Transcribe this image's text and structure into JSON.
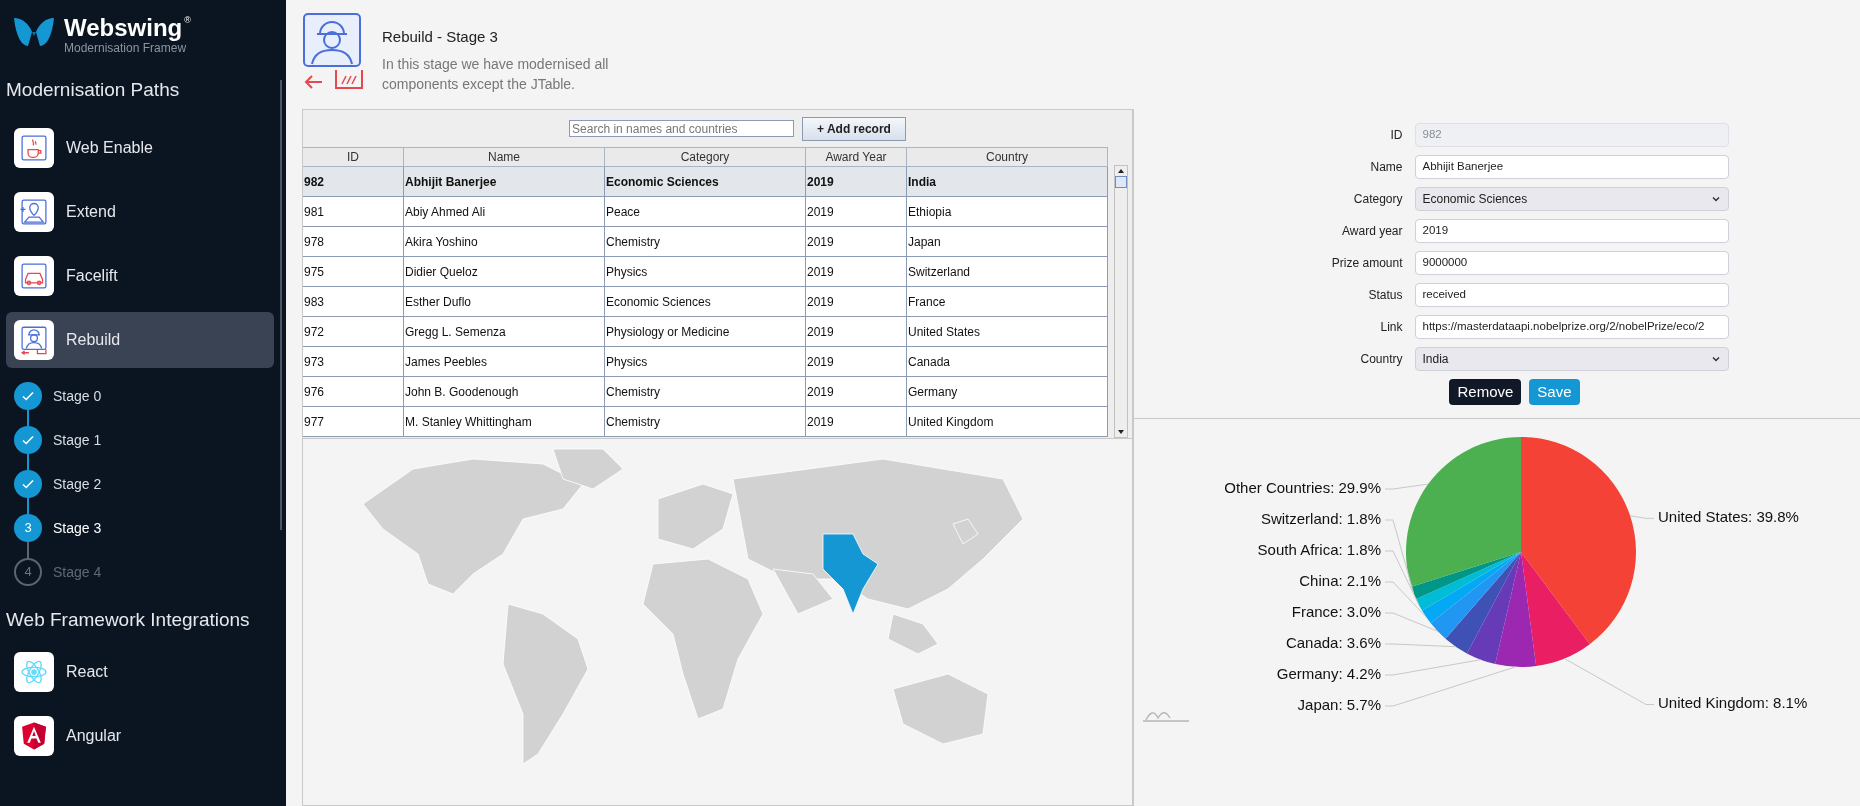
{
  "sidebar": {
    "brand": {
      "name": "Webswing",
      "mark": "®",
      "subtitle": "Modernisation Framew"
    },
    "sections": [
      {
        "title": "Modernisation Paths",
        "items": [
          {
            "label": "Web Enable",
            "selected": false
          },
          {
            "label": "Extend",
            "selected": false
          },
          {
            "label": "Facelift",
            "selected": false
          },
          {
            "label": "Rebuild",
            "selected": true
          }
        ],
        "stages": [
          {
            "label": "Stage 0",
            "kind": "done"
          },
          {
            "label": "Stage 1",
            "kind": "done"
          },
          {
            "label": "Stage 2",
            "kind": "done"
          },
          {
            "label": "Stage 3",
            "kind": "current",
            "number": "3"
          },
          {
            "label": "Stage 4",
            "kind": "pending",
            "number": "4"
          }
        ]
      },
      {
        "title": "Web Framework Integrations",
        "items": [
          {
            "label": "React",
            "selected": false
          },
          {
            "label": "Angular",
            "selected": false
          }
        ]
      }
    ]
  },
  "header": {
    "title": "Rebuild - Stage 3",
    "description": "In this stage we have modernised all components except the JTable."
  },
  "table": {
    "search": {
      "placeholder": "Search in names and countries"
    },
    "add_button": "+ Add record",
    "columns": [
      "ID",
      "Name",
      "Category",
      "Award Year",
      "Country"
    ],
    "rows": [
      {
        "cells": [
          "982",
          "Abhijit Banerjee",
          "Economic Sciences",
          "2019",
          "India"
        ],
        "selected": true
      },
      {
        "cells": [
          "981",
          "Abiy Ahmed Ali",
          "Peace",
          "2019",
          "Ethiopia"
        ],
        "selected": false
      },
      {
        "cells": [
          "978",
          "Akira Yoshino",
          "Chemistry",
          "2019",
          "Japan"
        ],
        "selected": false
      },
      {
        "cells": [
          "975",
          "Didier Queloz",
          "Physics",
          "2019",
          "Switzerland"
        ],
        "selected": false
      },
      {
        "cells": [
          "983",
          "Esther Duflo",
          "Economic Sciences",
          "2019",
          "France"
        ],
        "selected": false
      },
      {
        "cells": [
          "972",
          "Gregg L. Semenza",
          "Physiology or Medicine",
          "2019",
          "United States"
        ],
        "selected": false
      },
      {
        "cells": [
          "973",
          "James Peebles",
          "Physics",
          "2019",
          "Canada"
        ],
        "selected": false
      },
      {
        "cells": [
          "976",
          "John B. Goodenough",
          "Chemistry",
          "2019",
          "Germany"
        ],
        "selected": false
      },
      {
        "cells": [
          "977",
          "M. Stanley Whittingham",
          "Chemistry",
          "2019",
          "United Kingdom"
        ],
        "selected": false
      }
    ]
  },
  "form": {
    "fields": [
      {
        "label": "ID",
        "kind": "text",
        "value": "982",
        "disabled": true
      },
      {
        "label": "Name",
        "kind": "text",
        "value": "Abhijit Banerjee"
      },
      {
        "label": "Category",
        "kind": "select",
        "value": "Economic Sciences"
      },
      {
        "label": "Award year",
        "kind": "text",
        "value": "2019"
      },
      {
        "label": "Prize amount",
        "kind": "text",
        "value": "9000000"
      },
      {
        "label": "Status",
        "kind": "text",
        "value": "received"
      },
      {
        "label": "Link",
        "kind": "text",
        "value": "https://masterdataapi.nobelprize.org/2/nobelPrize/eco/2"
      },
      {
        "label": "Country",
        "kind": "select",
        "value": "India"
      }
    ],
    "buttons": [
      {
        "label": "Remove",
        "kind": "dark"
      },
      {
        "label": "Save",
        "kind": "primary"
      }
    ]
  },
  "chart": {
    "chart_data": {
      "type": "pie",
      "series": [
        {
          "values": [
            39.8,
            8.1,
            5.7,
            4.2,
            3.6,
            3.0,
            2.1,
            1.8,
            1.8,
            29.9
          ]
        }
      ],
      "colors": [
        "#f44336",
        "#e91e63",
        "#9c27b0",
        "#673ab7",
        "#3f51b5",
        "#2196f3",
        "#03a9f4",
        "#00bcd4",
        "#009688",
        "#4caf50"
      ],
      "value_labels": [
        "United States: 39.8%",
        "United Kingdom: 8.1%",
        "Japan: 5.7%",
        "Germany: 4.2%",
        "Canada: 3.6%",
        "France: 3.0%",
        "China: 2.1%",
        "South Africa: 1.8%",
        "Switzerland: 1.8%",
        "Other Countries: 29.9%"
      ]
    }
  }
}
